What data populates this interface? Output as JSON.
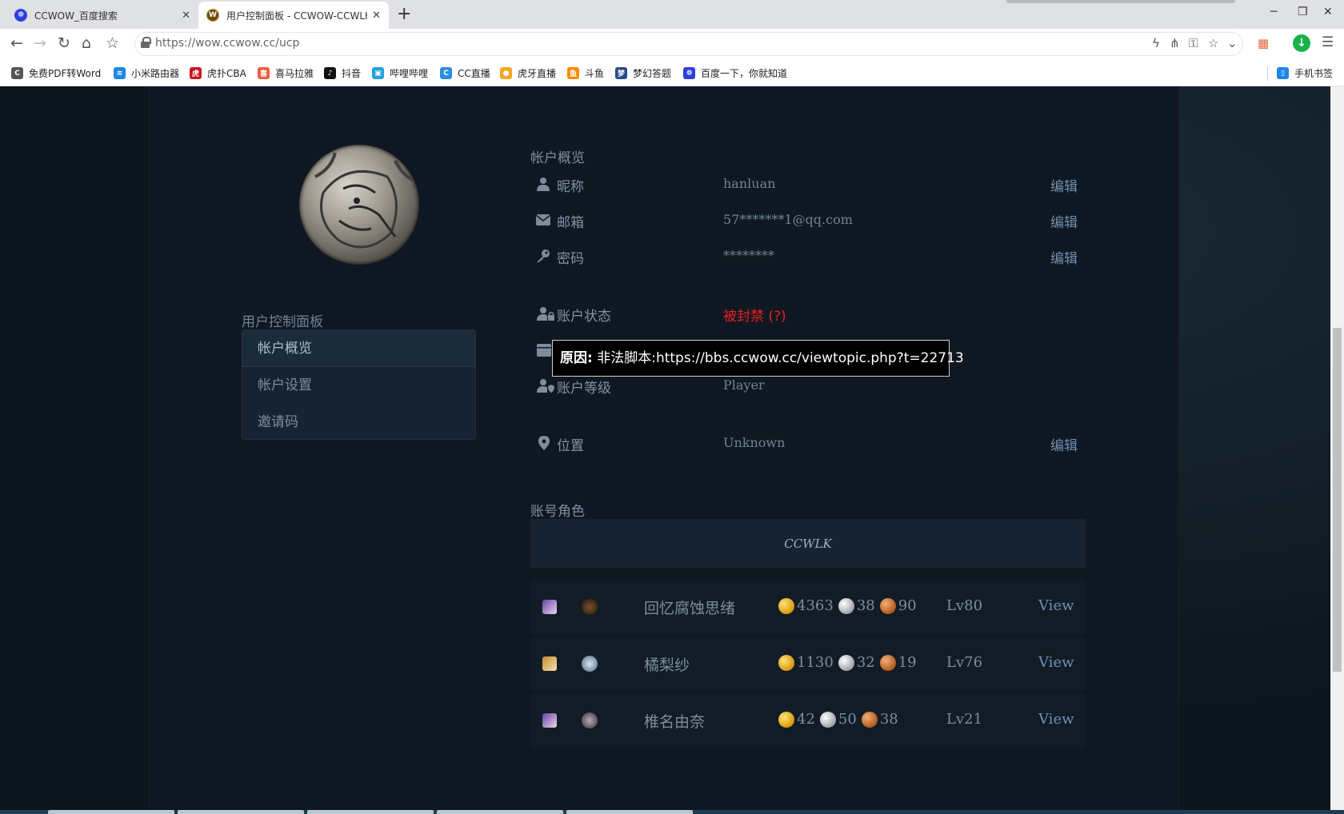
{
  "browser": {
    "tabs": [
      {
        "title": "CCWOW_百度搜索",
        "active": false
      },
      {
        "title": "用户控制面板 - CCWOW-CCWLK",
        "active": true
      }
    ],
    "url": "https://wow.ccwow.cc/ucp",
    "bookmarks": [
      "免费PDF转Word",
      "小米路由器",
      "虎扑CBA",
      "喜马拉雅",
      "抖音",
      "哔哩哔哩",
      "CC直播",
      "虎牙直播",
      "斗鱼",
      "梦幻答题",
      "百度一下，你就知道",
      "手机书签"
    ]
  },
  "sidebar": {
    "title": "用户控制面板",
    "items": [
      {
        "label": "帐户概览",
        "active": true
      },
      {
        "label": "帐户设置",
        "active": false
      },
      {
        "label": "邀请码",
        "active": false
      }
    ]
  },
  "overview": {
    "title": "帐户概览",
    "nickname": {
      "label": "昵称",
      "value": "hanluan",
      "edit": "编辑"
    },
    "email": {
      "label": "邮箱",
      "value": "57*******1@qq.com",
      "edit": "编辑"
    },
    "password": {
      "label": "密码",
      "value": "********",
      "edit": "编辑"
    },
    "status": {
      "label": "账户状态",
      "value": "被封禁 (?)"
    },
    "level": {
      "label": "账户等级",
      "value": "Player"
    },
    "location": {
      "label": "位置",
      "value": "Unknown",
      "edit": "编辑"
    }
  },
  "tooltip": {
    "prefix": "原因:",
    "text": " 非法脚本:https://bbs.ccwow.cc/viewtopic.php?t=22713"
  },
  "characters": {
    "title": "账号角色",
    "realm": "CCWLK",
    "list": [
      {
        "name": "回忆腐蚀思绪",
        "gold": "4363",
        "silver": "38",
        "copper": "90",
        "level": "Lv80",
        "view": "View"
      },
      {
        "name": "橘梨纱",
        "gold": "1130",
        "silver": "32",
        "copper": "19",
        "level": "Lv76",
        "view": "View"
      },
      {
        "name": "椎名由奈",
        "gold": "42",
        "silver": "50",
        "copper": "38",
        "level": "Lv21",
        "view": "View"
      }
    ]
  },
  "colors": {
    "background": "#0f1822",
    "banned": "#e8201e",
    "link": "#6f8fb0"
  }
}
